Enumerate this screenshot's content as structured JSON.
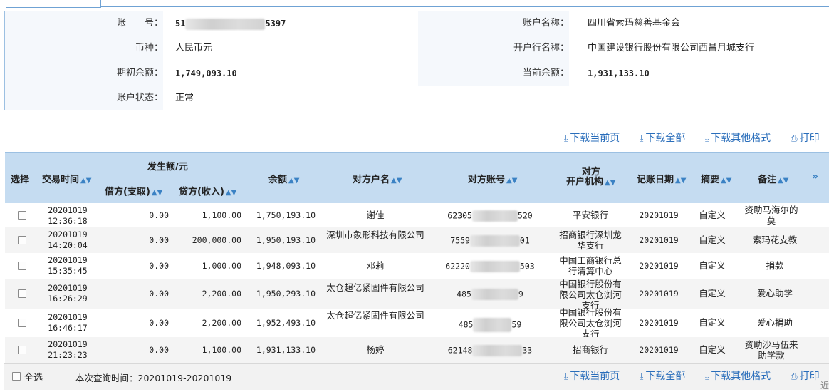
{
  "account_info": {
    "account_no_label": "账　　号：",
    "account_no_prefix": "51",
    "account_no_suffix": "5397",
    "account_name_label": "账户名称：",
    "account_name": "四川省索玛慈善基金会",
    "currency_label": "币种：",
    "currency": "人民币元",
    "bank_label": "开户行名称：",
    "bank": "中国建设银行股份有限公司西昌月城支行",
    "opening_balance_label": "期初余额：",
    "opening_balance": "1,749,093.10",
    "current_balance_label": "当前余额：",
    "current_balance": "1,931,133.10",
    "status_label": "账户状态：",
    "status": "正常"
  },
  "actions": {
    "download_page": "下载当前页",
    "download_all": "下载全部",
    "download_other": "下载其他格式",
    "print": "打印"
  },
  "table": {
    "headers": {
      "select": "选择",
      "time": "交易时间",
      "amount_group": "发生额/元",
      "debit": "借方(支取)",
      "credit": "贷方(收入)",
      "balance": "余额",
      "counterparty": "对方户名",
      "counterparty_account": "对方账号",
      "counterparty_bank_1": "对方",
      "counterparty_bank_2": "开户机构",
      "book_date": "记账日期",
      "summary": "摘要",
      "remark": "备注",
      "more": "»"
    },
    "rows": [
      {
        "date": "20201019",
        "time": "12:36:18",
        "debit": "0.00",
        "credit": "1,100.00",
        "balance": "1,750,193.10",
        "name": "谢佳",
        "acct_pre": "62305",
        "acct_suf": "520",
        "bank": "平安银行",
        "book": "20201019",
        "summary": "自定义",
        "remark": "资助马海尔的莫"
      },
      {
        "date": "20201019",
        "time": "14:20:04",
        "debit": "0.00",
        "credit": "200,000.00",
        "balance": "1,950,193.10",
        "name": "深圳市象形科技有限公司",
        "acct_pre": "7559",
        "acct_suf": "01",
        "bank": "招商银行深圳龙华支行",
        "book": "20201019",
        "summary": "自定义",
        "remark": "索玛花支教"
      },
      {
        "date": "20201019",
        "time": "15:35:45",
        "debit": "0.00",
        "credit": "1,000.00",
        "balance": "1,948,093.10",
        "name": "邓莉",
        "acct_pre": "62220",
        "acct_suf": "503",
        "bank": "中国工商银行总行清算中心",
        "book": "20201019",
        "summary": "自定义",
        "remark": "捐款"
      },
      {
        "date": "20201019",
        "time": "16:26:29",
        "debit": "0.00",
        "credit": "2,200.00",
        "balance": "1,950,293.10",
        "name": "太仓超亿紧固件有限公司",
        "acct_pre": "485",
        "acct_suf": "9",
        "bank": "中国银行股份有限公司太仓浏河支行",
        "book": "20201019",
        "summary": "自定义",
        "remark": "爱心助学"
      },
      {
        "date": "20201019",
        "time": "16:46:17",
        "debit": "0.00",
        "credit": "2,200.00",
        "balance": "1,952,493.10",
        "name": "太仓超亿紧固件有限公司",
        "acct_pre": "485",
        "acct_suf": "59",
        "bank": "中国银行股份有限公司太仓浏河支行",
        "book": "20201019",
        "summary": "自定义",
        "remark": "爱心捐助"
      },
      {
        "date": "20201019",
        "time": "21:23:23",
        "debit": "0.00",
        "credit": "1,100.00",
        "balance": "1,931,133.10",
        "name": "杨婷",
        "acct_pre": "62148",
        "acct_suf": "33",
        "bank": "招商银行",
        "book": "20201019",
        "summary": "自定义",
        "remark": "资助沙马伍来助学款"
      }
    ]
  },
  "footer": {
    "select_all": "全选",
    "query_time": "本次查询时间：20201019-20201019"
  },
  "corner_text": "近"
}
